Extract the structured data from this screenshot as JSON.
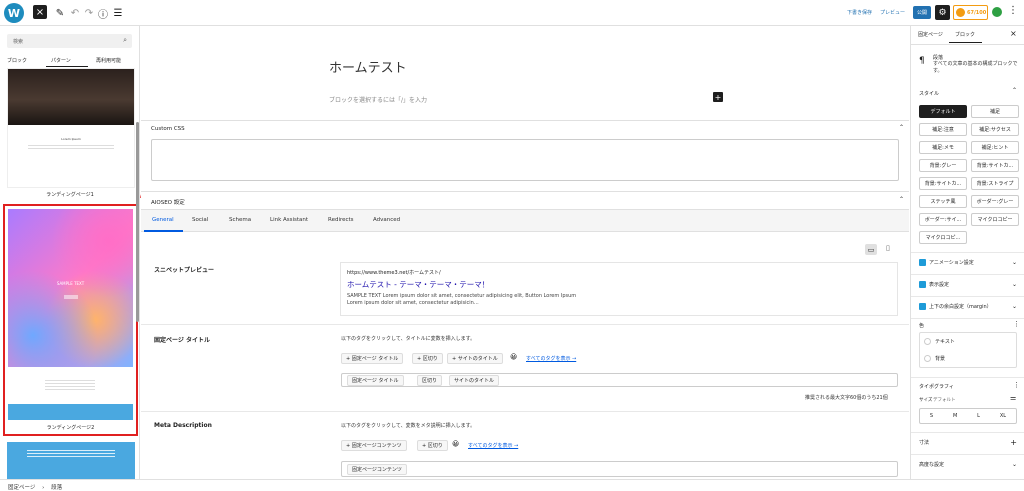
{
  "topbar": {
    "save_draft": "下書き保存",
    "preview": "プレビュー",
    "publish": "公開",
    "aioseo_score": "67/100"
  },
  "left_sidebar": {
    "search_placeholder": "検索",
    "tabs": [
      "ブロック",
      "パターン",
      "再利用可能"
    ],
    "pattern1_label": "ランディングページ1",
    "pattern2_label": "ランディングページ2",
    "thumb_text1": "Lorem Ipsum",
    "thumb_text2": "SAMPLE TEXT"
  },
  "canvas": {
    "page_title": "ホームテスト",
    "block_placeholder": "ブロックを選択するには「/」を入力",
    "custom_css_label": "Custom CSS",
    "aioseo_label": "AIOSEO 設定",
    "aioseo_tabs": [
      "General",
      "Social",
      "Schema",
      "Link Assistant",
      "Redirects",
      "Advanced"
    ],
    "snippet": {
      "label": "スニペットプレビュー",
      "url": "https://www.theme3.net/ホームテスト/",
      "title": "ホームテスト - テーマ・テーマ・テーマ！",
      "desc1": "SAMPLE TEXT Lorem ipsum dolor sit amet, consectetur adipisicing elit, Button Lorem Ipsum",
      "desc2": "Lorem ipsum dolor sit amet, consectetur adipisicin…"
    },
    "page_title_section": {
      "label": "固定ページ タイトル",
      "hint": "以下のタグをクリックして、タイトルに変数を挿入します。",
      "chips": [
        "+ 固定ページ タイトル",
        "+ 区切り",
        "+ サイトのタイトル"
      ],
      "show_all": "すべてのタグを表示 →",
      "tags": [
        "固定ページ タイトル",
        "区切り",
        "サイトのタイトル"
      ],
      "counter": "推奨される最大文字60個のうち21個"
    },
    "meta_section": {
      "label": "Meta Description",
      "hint": "以下のタグをクリックして、変数をメタ説明に挿入します。",
      "chips": [
        "+ 固定ページコンテンツ",
        "+ 区切り"
      ],
      "show_all": "すべてのタグを表示 →",
      "tags": [
        "固定ページコンテンツ"
      ]
    }
  },
  "right_sidebar": {
    "tabs": [
      "固定ページ",
      "ブロック"
    ],
    "block_name": "段落",
    "block_desc": "すべての文章の基本の構成ブロックです。",
    "style_label": "スタイル",
    "styles": [
      "デフォルト",
      "補足",
      "補足:注意",
      "補足:サクセス",
      "補足:メモ",
      "補足:ヒント",
      "背景:グレー",
      "背景:サイトカ...",
      "背景:サイトカ...",
      "背景:ストライプ",
      "ステッチ風",
      "ボーダー:グレー",
      "ボーダー:サイ...",
      "マイクロコピー",
      "マイクロコピ..."
    ],
    "panels": [
      "アニメーション設定",
      "表示設定",
      "上下の余白設定（margin）"
    ],
    "color_label": "色",
    "color_items": [
      "テキスト",
      "背景"
    ],
    "typography_label": "タイポグラフィ",
    "size_label": "サイズ",
    "size_default": "デフォルト",
    "sizes": [
      "S",
      "M",
      "L",
      "XL"
    ],
    "dimensions_label": "寸法",
    "advanced_label": "高度な設定"
  },
  "footer": {
    "breadcrumb1": "固定ページ",
    "breadcrumb2": "段落"
  }
}
